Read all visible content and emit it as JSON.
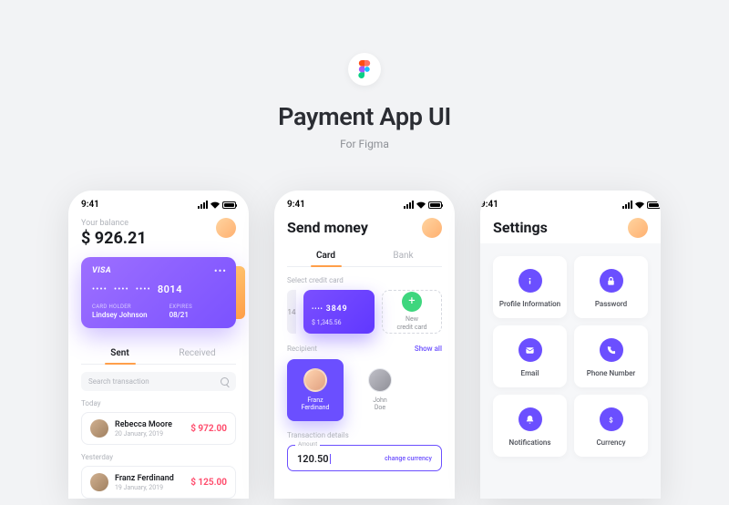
{
  "hero": {
    "title": "Payment App UI",
    "subtitle": "For Figma"
  },
  "status_time": "9:41",
  "balance": {
    "label": "Your balance",
    "value": "$ 926.21"
  },
  "card": {
    "brand": "VISA",
    "last4": "8014",
    "holder_label": "CARD HOLDER",
    "holder": "Lindsey Johnson",
    "exp_label": "EXPIRES",
    "exp": "08/21"
  },
  "tabs_home": {
    "sent": "Sent",
    "received": "Received"
  },
  "search_placeholder": "Search transaction",
  "today_label": "Today",
  "yesterday_label": "Yesterday",
  "tx1": {
    "name": "Rebecca Moore",
    "date": "20 January, 2019",
    "amount": "$ 972.00"
  },
  "tx2": {
    "name": "Franz Ferdinand",
    "date": "19 January, 2019",
    "amount": "$ 125.00"
  },
  "send": {
    "title": "Send money",
    "tab_card": "Card",
    "tab_bank": "Bank",
    "select_label": "Select credit card",
    "cc_last4": "3849",
    "cc_balance": "$ 1,345.56",
    "cc_edge": "14",
    "new_card": "New\ncredit card",
    "recipient_label": "Recipient",
    "show_all": "Show all",
    "r1": "Franz\nFerdinand",
    "r2": "John\nDoe",
    "details_label": "Transaction details",
    "amount_label": "Amount",
    "amount": "120.50",
    "change_currency": "change currency"
  },
  "settings": {
    "title": "Settings",
    "items": [
      "Profile Information",
      "Password",
      "Email",
      "Phone Number",
      "Notifications",
      "Currency"
    ]
  }
}
